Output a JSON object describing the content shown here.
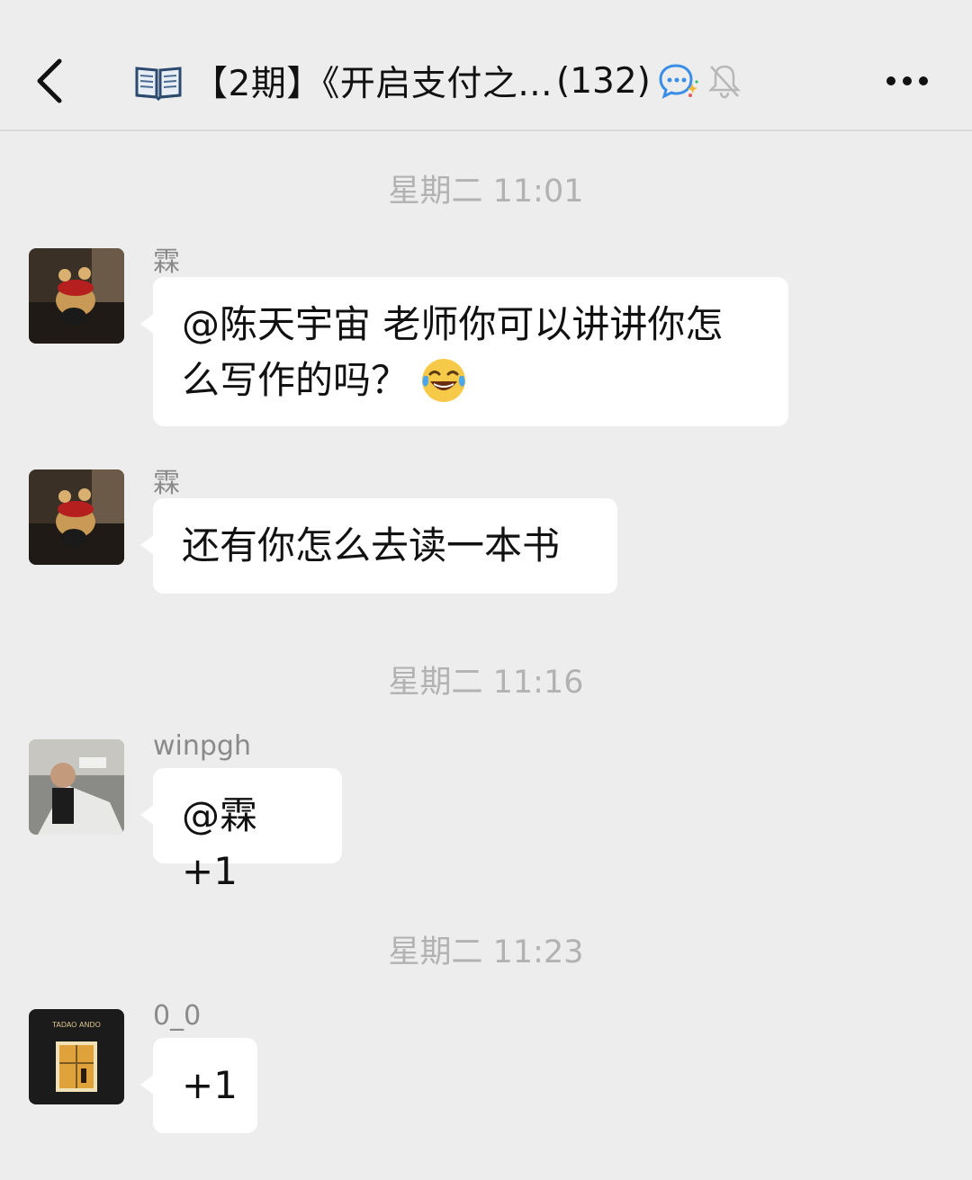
{
  "header": {
    "title": "【2期】《开启支付之...",
    "member_count": "(132)",
    "book_icon": "open-book-icon",
    "status_icons": [
      "chat-bubble-icon",
      "muted-bell-icon"
    ],
    "back_icon": "chevron-left-icon",
    "more_icon": "more-dots-icon"
  },
  "timestamps": [
    "星期二 11:01",
    "星期二 11:16",
    "星期二 11:23"
  ],
  "messages": [
    {
      "sender": "霖",
      "text": "@陈天宇宙 老师你可以讲讲你怎么写作的吗？",
      "line1": "@陈天宇宙 老师你可以讲讲你怎",
      "line2": "么写作的吗？",
      "emoji": "laughing-tears-emoji"
    },
    {
      "sender": "霖",
      "text": "还有你怎么去读一本书"
    },
    {
      "sender": "winpgh",
      "text": "@霖 +1"
    },
    {
      "sender": "0_0",
      "text": "+1",
      "avatar_caption": "TADAO ANDO"
    }
  ]
}
